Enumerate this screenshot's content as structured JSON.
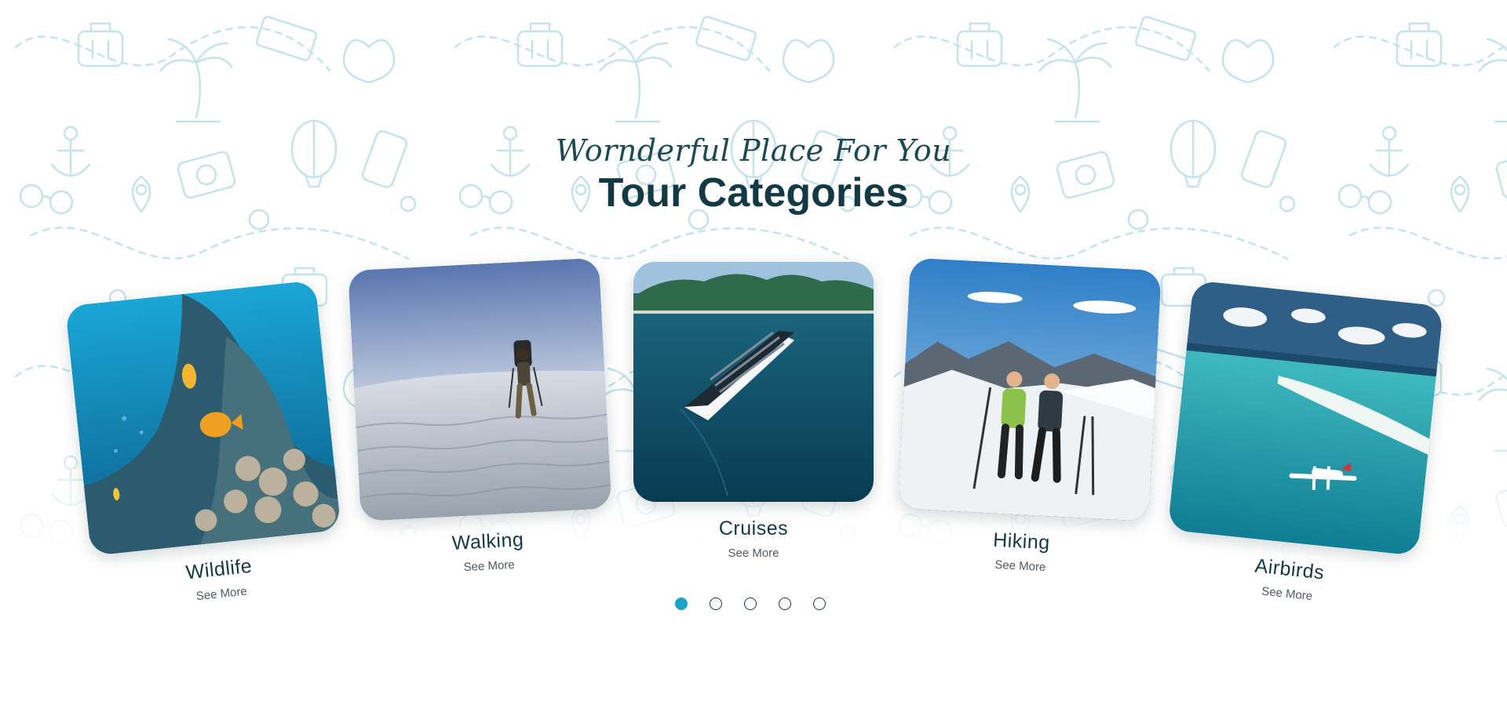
{
  "section": {
    "subtitle": "Wornderful Place For You",
    "title": "Tour Categories"
  },
  "categories": [
    {
      "label": "Wildlife",
      "link": "See More",
      "image": "coral-reef-fish-photo"
    },
    {
      "label": "Walking",
      "link": "See More",
      "image": "desert-hiker-photo"
    },
    {
      "label": "Cruises",
      "link": "See More",
      "image": "cruise-ship-photo"
    },
    {
      "label": "Hiking",
      "link": "See More",
      "image": "snow-hikers-photo"
    },
    {
      "label": "Airbirds",
      "link": "See More",
      "image": "seaplane-lagoon-photo"
    }
  ],
  "pagination": {
    "count": 5,
    "active_index": 0
  },
  "colors": {
    "accent": "#1ba3c9",
    "heading": "#133a44",
    "pattern": "#bfe0ea"
  }
}
